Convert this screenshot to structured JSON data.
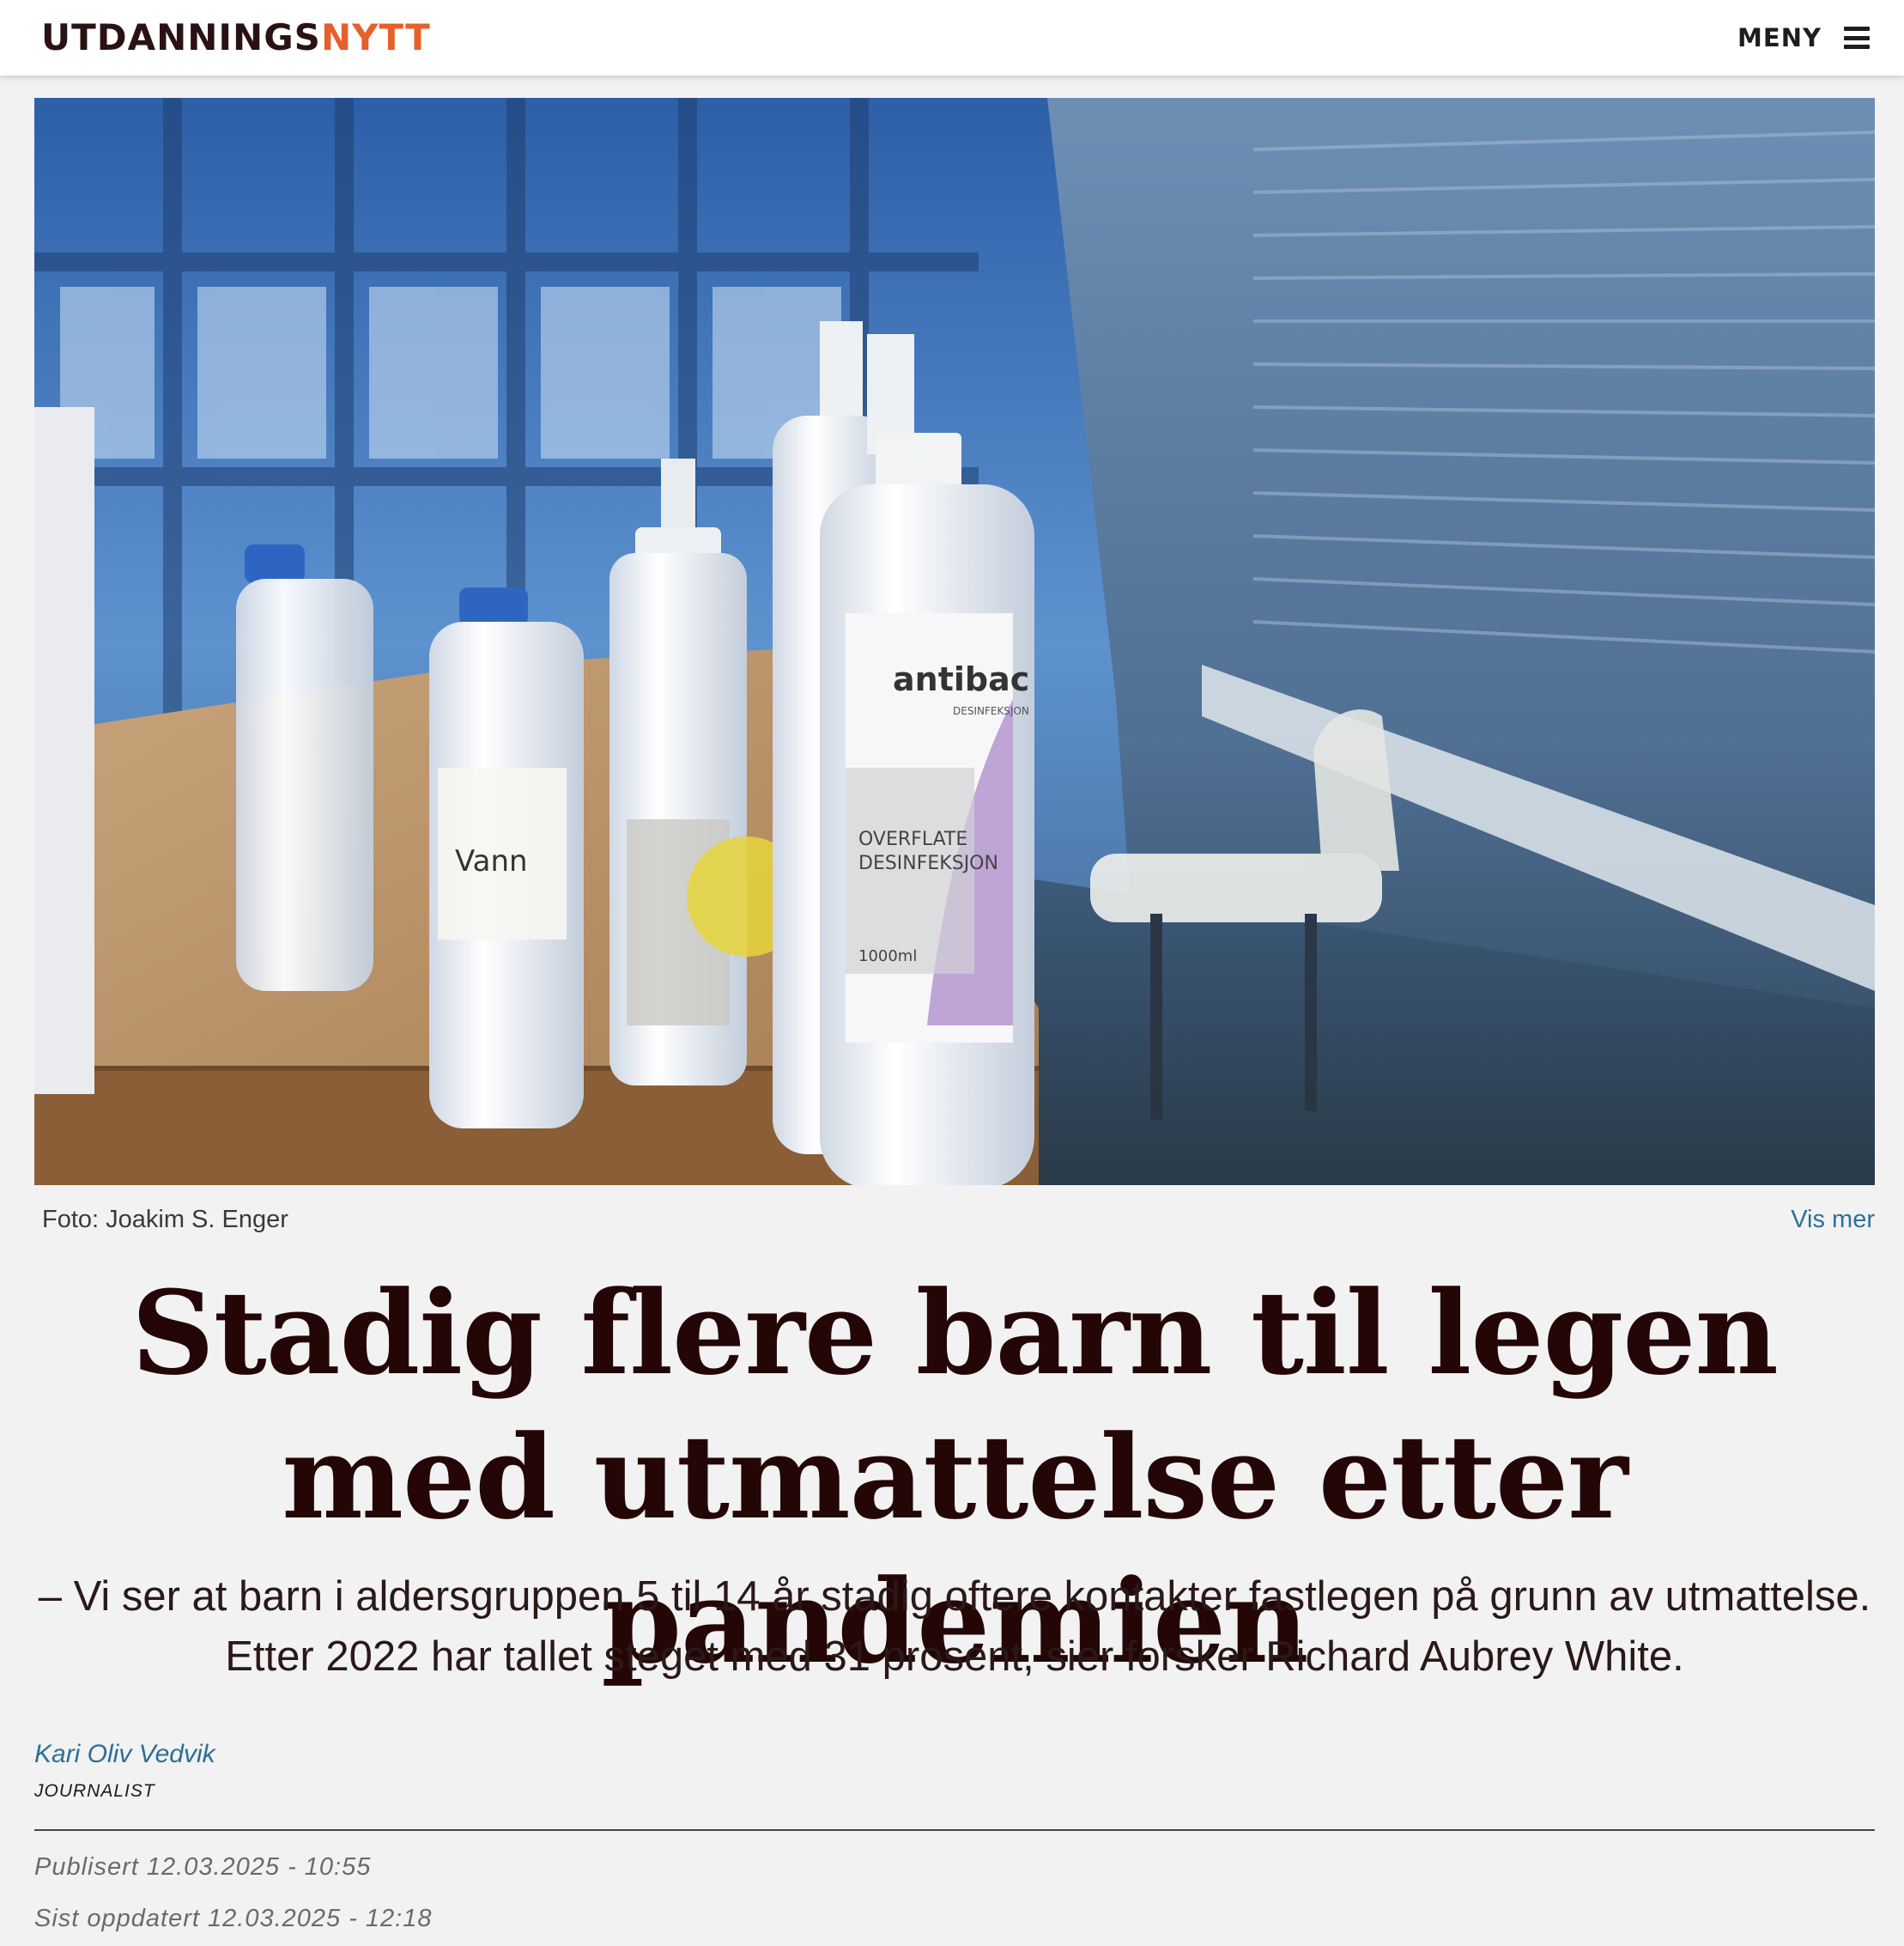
{
  "header": {
    "logo_part1": "UTDANNINGS",
    "logo_part2": "NYTT",
    "menu_label": "MENY"
  },
  "hero": {
    "photo_credit": "Foto: Joakim S. Enger",
    "show_more": "Vis mer",
    "bottle_label_brand": "antibac",
    "bottle_label_sub": "DESINFEKSJON",
    "bottle_label_line1": "OVERFLATE",
    "bottle_label_line2": "DESINFEKSJON",
    "bottle_volume": "1000ml"
  },
  "article": {
    "headline": "Stadig flere barn til legen med utmattelse etter pandemien",
    "lead": "– Vi ser at barn i aldersgruppen 5 til 14 år stadig oftere kontakter fastlegen på grunn av utmattelse. Etter 2022 har tallet steget med 31 prosent, sier forsker Richard Aubrey White.",
    "author_name": "Kari Oliv Vedvik",
    "author_role": "JOURNALIST",
    "published": "Publisert 12.03.2025 - 10:55",
    "updated": "Sist oppdatert 12.03.2025 - 12:18"
  },
  "colors": {
    "logo_dark": "#2b1212",
    "logo_accent": "#e5602a",
    "link": "#2d6f97",
    "headline": "#240606",
    "background": "#f2f2f2"
  }
}
